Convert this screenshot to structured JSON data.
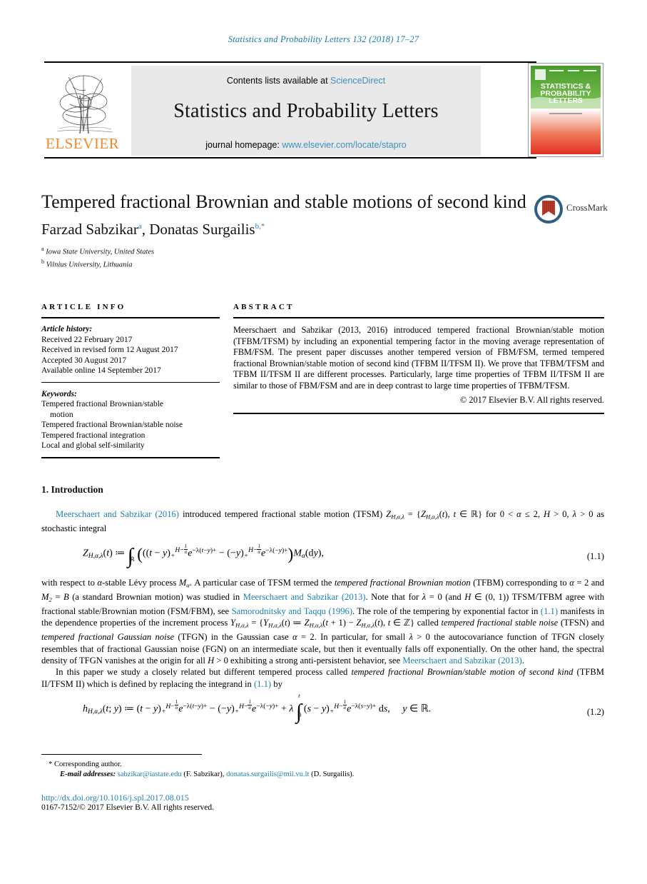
{
  "running_head": "Statistics and Probability Letters 132 (2018) 17–27",
  "masthead": {
    "contents_prefix": "Contents lists available at ",
    "contents_link": "ScienceDirect",
    "journal_name": "Statistics and Probability Letters",
    "homepage_prefix": "journal homepage: ",
    "homepage_link": "www.elsevier.com/locate/stapro",
    "publisher": "ELSEVIER",
    "cover_title_line1": "STATISTICS &",
    "cover_title_line2": "PROBABILITY",
    "cover_title_line3": "LETTERS"
  },
  "article": {
    "title": "Tempered fractional Brownian and stable motions of second kind",
    "authors_part1": "Farzad Sabzikar",
    "author1_mark": "a",
    "authors_sep": ", ",
    "authors_part2": "Donatas Surgailis",
    "author2_mark": "b,*",
    "affiliation_a_mark": "a",
    "affiliation_a": "Iowa State University, United States",
    "affiliation_b_mark": "b",
    "affiliation_b": "Vilnius University, Lithuania",
    "crossmark_label": "CrossMark"
  },
  "article_info": {
    "heading": "ARTICLE INFO",
    "history_label": "Article history:",
    "history": [
      "Received 22 February 2017",
      "Received in revised form 12 August 2017",
      "Accepted 30 August 2017",
      "Available online 14 September 2017"
    ],
    "keywords_label": "Keywords:",
    "keywords": [
      "Tempered fractional Brownian/stable",
      "motion",
      "Tempered fractional Brownian/stable noise",
      "Tempered fractional integration",
      "Local and global self-similarity"
    ]
  },
  "abstract": {
    "heading": "ABSTRACT",
    "text": "Meerschaert and Sabzikar (2013, 2016) introduced tempered fractional Brownian/stable motion (TFBM/TFSM) by including an exponential tempering factor in the moving average representation of FBM/FSM. The present paper discusses another tempered version of FBM/FSM, termed tempered fractional Brownian/stable motion of second kind (TFBM II/TFSM II). We prove that TFBM/TFSM and TFBM II/TFSM II are different processes. Particularly, large time properties of TFBM II/TFSM II are similar to those of FBM/FSM and are in deep contrast to large time properties of TFBM/TFSM.",
    "copyright": "© 2017 Elsevier B.V. All rights reserved."
  },
  "introduction": {
    "section_number_title": "1. Introduction",
    "p1_ref_link": "Meerschaert and Sabzikar",
    "p1_year": "(2016)",
    "p1_a": " introduced tempered fractional stable motion  (TFSM) ",
    "p1_b": " for",
    "p1_c": " as stochastic integral",
    "eq11_number": "(1.1)",
    "p2_a": "with respect to ",
    "p2_b": "-stable Lévy process ",
    "p2_c": ". A particular case of TFSM termed the ",
    "p2_italic1": "tempered fractional Brownian motion",
    "p2_d": " (TFBM) corresponding to ",
    "p2_e": " and ",
    "p2_f": " (a standard Brownian motion) was studied in ",
    "p2_ref1": "Meerschaert and Sabzikar",
    "p2_ref1_year": "(2013)",
    "p2_g": ". Note that for ",
    "p2_h": " (and ",
    "p2_i": ") TFSM/TFBM agree with fractional stable/Brownian motion (FSM/FBM), see ",
    "p2_ref2": "Samorodnitsky and Taqqu",
    "p2_ref2_year": "(1996)",
    "p2_j": ". The role of the tempering by exponential factor in ",
    "p2_eqref": "(1.1)",
    "p2_k": " manifests in the dependence properties of the increment process ",
    "p2_l": " called ",
    "p2_italic2": "tempered fractional stable noise",
    "p2_m": " (TFSN) and ",
    "p2_italic3": "tempered fractional Gaussian noise",
    "p2_n": " (TFGN) in the Gaussian case ",
    "p2_o": ". In particular, for small ",
    "p2_p": " the autocovariance function of TFGN closely resembles that of fractional Gaussian noise (FGN) on an intermediate scale, but then it eventually falls off exponentially. On the other hand, the spectral density of TFGN vanishes at the origin for all ",
    "p2_q": " exhibiting a strong anti-persistent behavior, see ",
    "p2_ref3": "Meerschaert and Sabzikar",
    "p2_ref3_year": "(2013)",
    "p2_r": ".",
    "p3_a": "In this paper we study a closely related but different tempered process called ",
    "p3_italic": "tempered fractional Brownian/stable motion of second kind",
    "p3_b": " (TFBM II/TFSM II) which is defined by replacing the integrand in ",
    "p3_eqref": "(1.1)",
    "p3_c": " by",
    "eq12_number": "(1.2)"
  },
  "footnotes": {
    "star_mark": "*",
    "corresponding": "Corresponding author.",
    "email_label": "E-mail addresses:",
    "email1": "sabzikar@iastate.edu",
    "email1_owner": " (F. Sabzikar), ",
    "email2": "donatas.surgailis@mii.vu.lt",
    "email2_owner": " (D. Surgailis).",
    "doi": "http://dx.doi.org/10.1016/j.spl.2017.08.015",
    "issn": "0167-7152/© 2017 Elsevier B.V. All rights reserved."
  },
  "colors": {
    "link_blue": "#1c7fb0",
    "masthead_link": "#3d8fbf",
    "elsevier_orange": "#f1892e",
    "running_head": "#1479a8",
    "masthead_bg": "#e9e9e9"
  }
}
